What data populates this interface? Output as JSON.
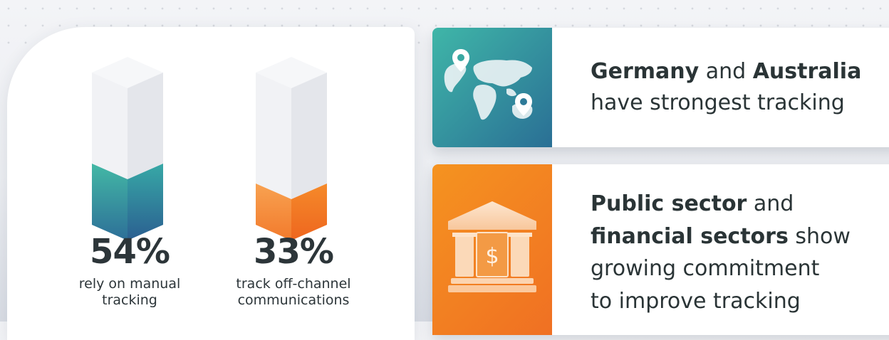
{
  "stats": [
    {
      "value": "54%",
      "label_line1": "rely on manual",
      "label_line2": "tracking",
      "fill_fraction": 0.54,
      "color_top": "#42b7a6",
      "color_bottom": "#2a6f95"
    },
    {
      "value": "33%",
      "label_line1": "track off-channel",
      "label_line2": "communications",
      "fill_fraction": 0.33,
      "color_top": "#f7a14d",
      "color_bottom": "#f06d22"
    }
  ],
  "cards": [
    {
      "icon": "world-map-icon",
      "line1_bold_a": "Germany",
      "line1_plain": " and ",
      "line1_bold_b": "Australia",
      "line2": "have strongest tracking",
      "gradient": [
        "#3fb6a8",
        "#2a6f95"
      ]
    },
    {
      "icon": "bank-dollar-icon",
      "line1_bold": "Public sector",
      "line1_plain": " and",
      "line2_bold": "financial sectors",
      "line2_plain": " show",
      "line3": "growing commitment",
      "line4": "to improve tracking",
      "gradient": [
        "#f59320",
        "#f07023"
      ]
    }
  ]
}
